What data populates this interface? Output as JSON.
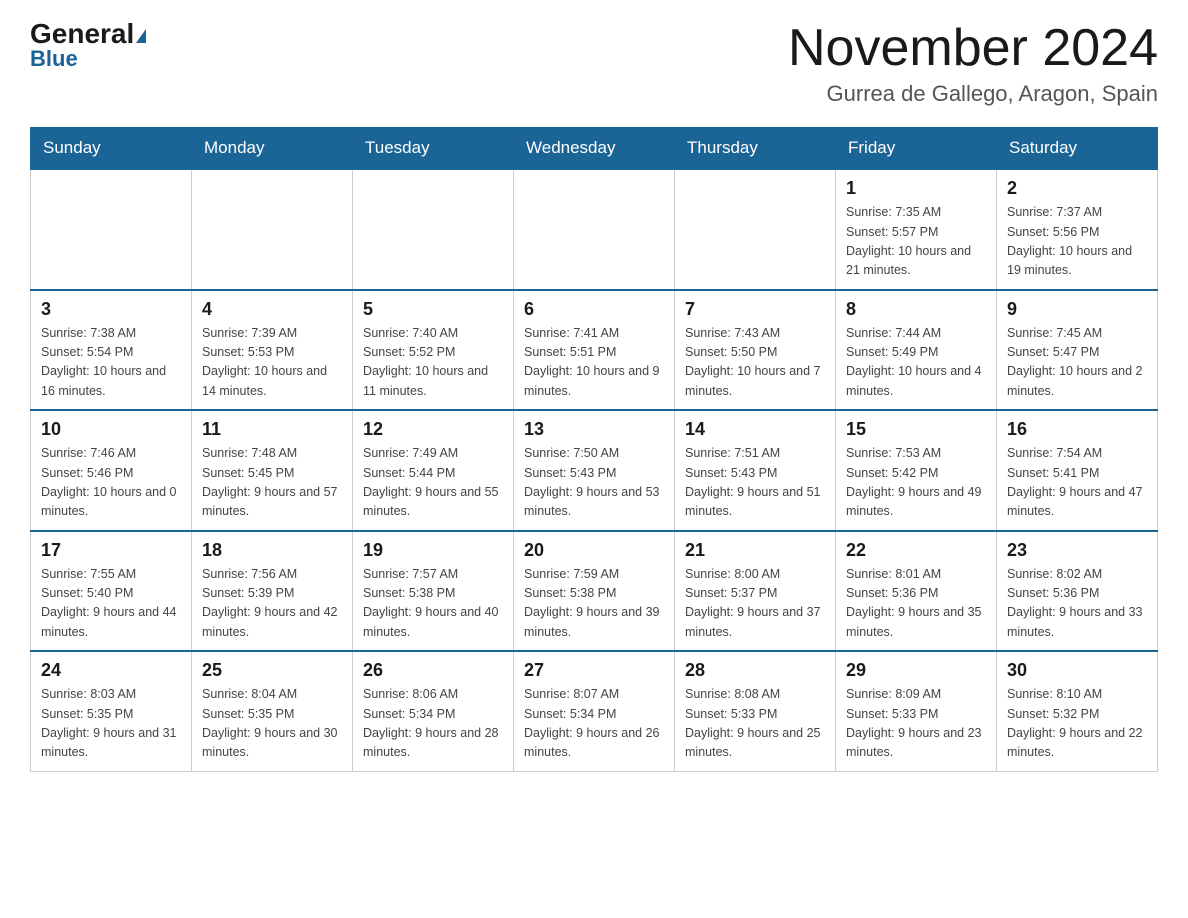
{
  "header": {
    "logo_general": "General",
    "logo_blue": "Blue",
    "month_title": "November 2024",
    "location": "Gurrea de Gallego, Aragon, Spain"
  },
  "weekdays": [
    "Sunday",
    "Monday",
    "Tuesday",
    "Wednesday",
    "Thursday",
    "Friday",
    "Saturday"
  ],
  "weeks": [
    {
      "days": [
        {
          "num": "",
          "info": ""
        },
        {
          "num": "",
          "info": ""
        },
        {
          "num": "",
          "info": ""
        },
        {
          "num": "",
          "info": ""
        },
        {
          "num": "",
          "info": ""
        },
        {
          "num": "1",
          "info": "Sunrise: 7:35 AM\nSunset: 5:57 PM\nDaylight: 10 hours and 21 minutes."
        },
        {
          "num": "2",
          "info": "Sunrise: 7:37 AM\nSunset: 5:56 PM\nDaylight: 10 hours and 19 minutes."
        }
      ]
    },
    {
      "days": [
        {
          "num": "3",
          "info": "Sunrise: 7:38 AM\nSunset: 5:54 PM\nDaylight: 10 hours and 16 minutes."
        },
        {
          "num": "4",
          "info": "Sunrise: 7:39 AM\nSunset: 5:53 PM\nDaylight: 10 hours and 14 minutes."
        },
        {
          "num": "5",
          "info": "Sunrise: 7:40 AM\nSunset: 5:52 PM\nDaylight: 10 hours and 11 minutes."
        },
        {
          "num": "6",
          "info": "Sunrise: 7:41 AM\nSunset: 5:51 PM\nDaylight: 10 hours and 9 minutes."
        },
        {
          "num": "7",
          "info": "Sunrise: 7:43 AM\nSunset: 5:50 PM\nDaylight: 10 hours and 7 minutes."
        },
        {
          "num": "8",
          "info": "Sunrise: 7:44 AM\nSunset: 5:49 PM\nDaylight: 10 hours and 4 minutes."
        },
        {
          "num": "9",
          "info": "Sunrise: 7:45 AM\nSunset: 5:47 PM\nDaylight: 10 hours and 2 minutes."
        }
      ]
    },
    {
      "days": [
        {
          "num": "10",
          "info": "Sunrise: 7:46 AM\nSunset: 5:46 PM\nDaylight: 10 hours and 0 minutes."
        },
        {
          "num": "11",
          "info": "Sunrise: 7:48 AM\nSunset: 5:45 PM\nDaylight: 9 hours and 57 minutes."
        },
        {
          "num": "12",
          "info": "Sunrise: 7:49 AM\nSunset: 5:44 PM\nDaylight: 9 hours and 55 minutes."
        },
        {
          "num": "13",
          "info": "Sunrise: 7:50 AM\nSunset: 5:43 PM\nDaylight: 9 hours and 53 minutes."
        },
        {
          "num": "14",
          "info": "Sunrise: 7:51 AM\nSunset: 5:43 PM\nDaylight: 9 hours and 51 minutes."
        },
        {
          "num": "15",
          "info": "Sunrise: 7:53 AM\nSunset: 5:42 PM\nDaylight: 9 hours and 49 minutes."
        },
        {
          "num": "16",
          "info": "Sunrise: 7:54 AM\nSunset: 5:41 PM\nDaylight: 9 hours and 47 minutes."
        }
      ]
    },
    {
      "days": [
        {
          "num": "17",
          "info": "Sunrise: 7:55 AM\nSunset: 5:40 PM\nDaylight: 9 hours and 44 minutes."
        },
        {
          "num": "18",
          "info": "Sunrise: 7:56 AM\nSunset: 5:39 PM\nDaylight: 9 hours and 42 minutes."
        },
        {
          "num": "19",
          "info": "Sunrise: 7:57 AM\nSunset: 5:38 PM\nDaylight: 9 hours and 40 minutes."
        },
        {
          "num": "20",
          "info": "Sunrise: 7:59 AM\nSunset: 5:38 PM\nDaylight: 9 hours and 39 minutes."
        },
        {
          "num": "21",
          "info": "Sunrise: 8:00 AM\nSunset: 5:37 PM\nDaylight: 9 hours and 37 minutes."
        },
        {
          "num": "22",
          "info": "Sunrise: 8:01 AM\nSunset: 5:36 PM\nDaylight: 9 hours and 35 minutes."
        },
        {
          "num": "23",
          "info": "Sunrise: 8:02 AM\nSunset: 5:36 PM\nDaylight: 9 hours and 33 minutes."
        }
      ]
    },
    {
      "days": [
        {
          "num": "24",
          "info": "Sunrise: 8:03 AM\nSunset: 5:35 PM\nDaylight: 9 hours and 31 minutes."
        },
        {
          "num": "25",
          "info": "Sunrise: 8:04 AM\nSunset: 5:35 PM\nDaylight: 9 hours and 30 minutes."
        },
        {
          "num": "26",
          "info": "Sunrise: 8:06 AM\nSunset: 5:34 PM\nDaylight: 9 hours and 28 minutes."
        },
        {
          "num": "27",
          "info": "Sunrise: 8:07 AM\nSunset: 5:34 PM\nDaylight: 9 hours and 26 minutes."
        },
        {
          "num": "28",
          "info": "Sunrise: 8:08 AM\nSunset: 5:33 PM\nDaylight: 9 hours and 25 minutes."
        },
        {
          "num": "29",
          "info": "Sunrise: 8:09 AM\nSunset: 5:33 PM\nDaylight: 9 hours and 23 minutes."
        },
        {
          "num": "30",
          "info": "Sunrise: 8:10 AM\nSunset: 5:32 PM\nDaylight: 9 hours and 22 minutes."
        }
      ]
    }
  ]
}
